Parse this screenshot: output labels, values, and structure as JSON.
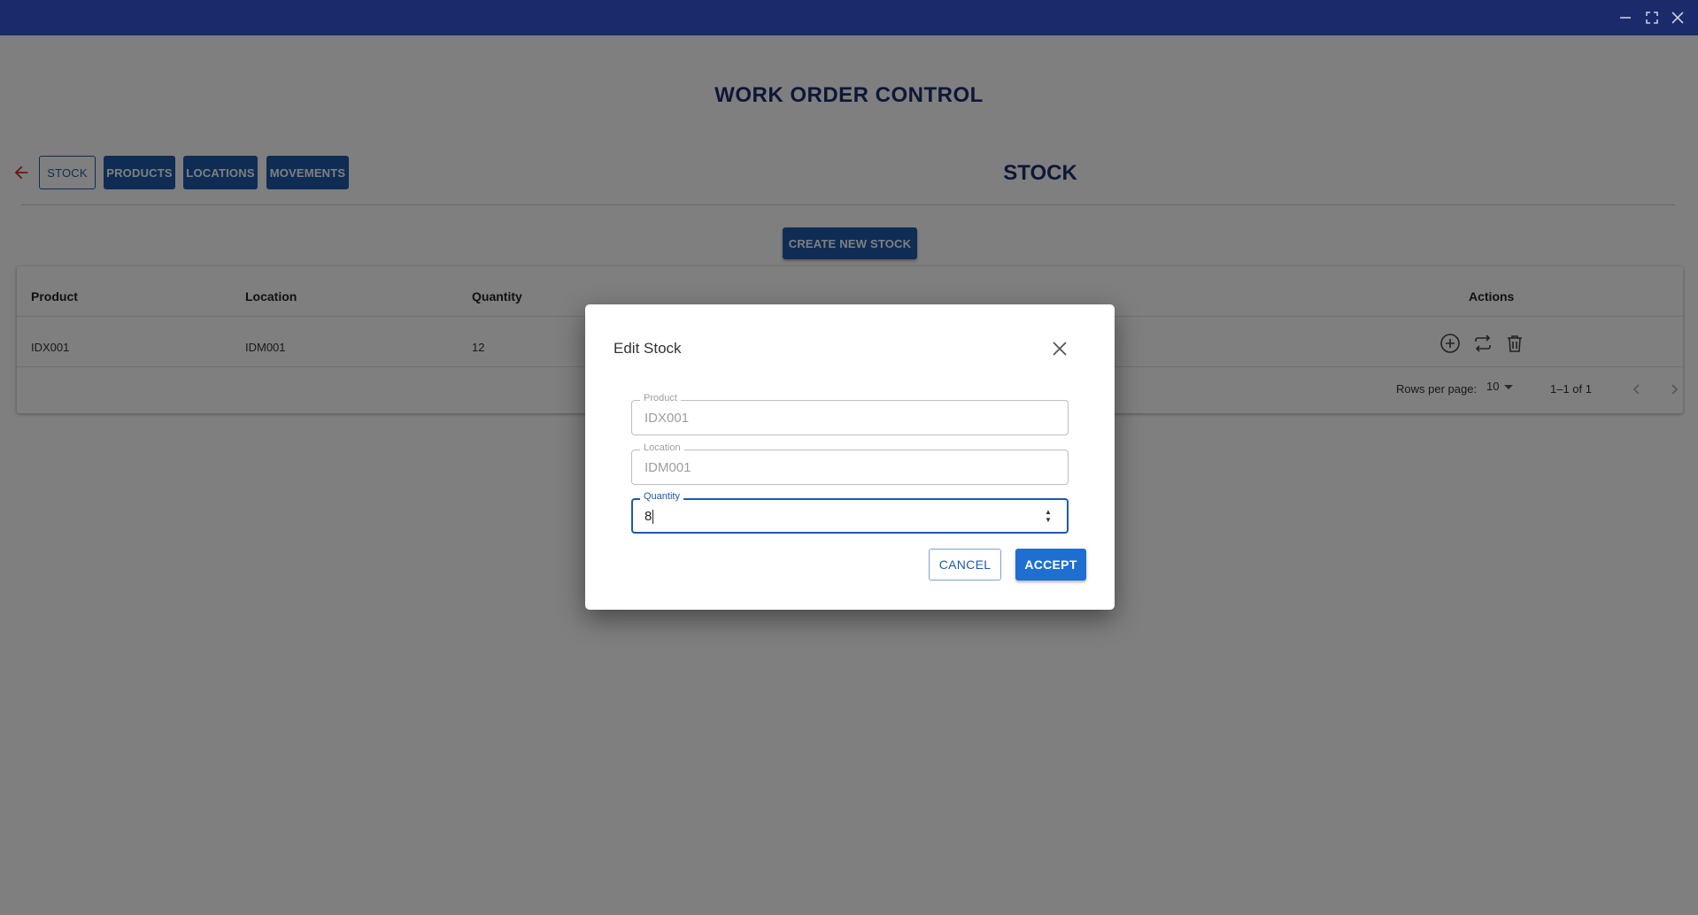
{
  "window": {
    "controls": [
      "minimize-icon",
      "maximize-icon",
      "close-icon"
    ]
  },
  "app": {
    "title": "WORK ORDER CONTROL"
  },
  "nav": {
    "back_icon": "arrow-left-icon",
    "tabs": [
      {
        "label": "STOCK",
        "active": true
      },
      {
        "label": "PRODUCTS",
        "active": false
      },
      {
        "label": "LOCATIONS",
        "active": false
      },
      {
        "label": "MOVEMENTS",
        "active": false
      }
    ]
  },
  "section": {
    "title": "STOCK",
    "create_button": "CREATE NEW STOCK"
  },
  "table": {
    "headers": {
      "product": "Product",
      "location": "Location",
      "quantity": "Quantity",
      "actions": "Actions"
    },
    "rows": [
      {
        "product": "IDX001",
        "location": "IDM001",
        "quantity": "12",
        "actions": [
          "add-circle-icon",
          "transfer-icon",
          "trash-icon"
        ]
      }
    ],
    "pagination": {
      "rows_per_page_label": "Rows per page:",
      "rows_per_page": "10",
      "range": "1–1 of 1"
    }
  },
  "dialog": {
    "title": "Edit Stock",
    "fields": {
      "product": {
        "label": "Product",
        "value": "IDX001",
        "disabled": true
      },
      "location": {
        "label": "Location",
        "value": "IDM001",
        "disabled": true
      },
      "quantity": {
        "label": "Quantity",
        "value": "8",
        "focused": true
      }
    },
    "cancel_label": "CANCEL",
    "accept_label": "ACCEPT"
  },
  "colors": {
    "titlebar": "#1a2a6b",
    "primary": "#1e5aa8",
    "accept": "#1e6fd1",
    "heading": "#1c2e6e",
    "back_arrow": "#d32f2f"
  }
}
